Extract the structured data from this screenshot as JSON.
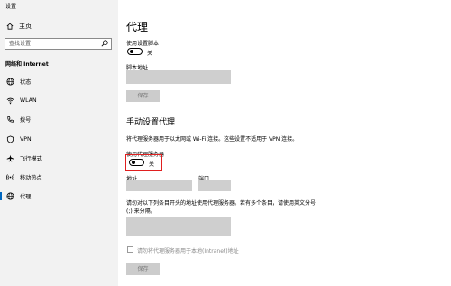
{
  "window_title": "设置",
  "sidebar": {
    "home_label": "主页",
    "search_placeholder": "查找设置",
    "section_title": "网络和 Internet",
    "items": [
      {
        "label": "状态",
        "icon": "globe-icon"
      },
      {
        "label": "WLAN",
        "icon": "wifi-icon"
      },
      {
        "label": "拨号",
        "icon": "phone-icon"
      },
      {
        "label": "VPN",
        "icon": "vpn-icon"
      },
      {
        "label": "飞行模式",
        "icon": "airplane-icon"
      },
      {
        "label": "移动热点",
        "icon": "hotspot-icon"
      },
      {
        "label": "代理",
        "icon": "globe-icon",
        "active": true
      }
    ]
  },
  "main": {
    "title": "代理",
    "auto": {
      "use_script_label": "使用设置脚本",
      "toggle_state": "关",
      "script_address_label": "脚本地址",
      "save_label": "保存"
    },
    "manual": {
      "heading": "手动设置代理",
      "description": "将代理服务器用于以太网或 Wi-Fi 连接。这些设置不适用于 VPN 连接。",
      "use_proxy_label": "使用代理服务器",
      "toggle_state": "关",
      "address_label": "地址",
      "port_label": "端口",
      "exceptions_text": "请勿对以下列条目开头的地址使用代理服务器。若有多个条目，请使用英文分号 (;) 来分隔。",
      "local_checkbox_label": "请勿将代理服务器用于本地(Intranet)地址",
      "save_label": "保存"
    }
  },
  "colors": {
    "sidebar_bg": "#f2f2f2",
    "accent": "#0067c0",
    "highlight_border": "#e01f1f",
    "input_bg": "#cfcfcf"
  }
}
